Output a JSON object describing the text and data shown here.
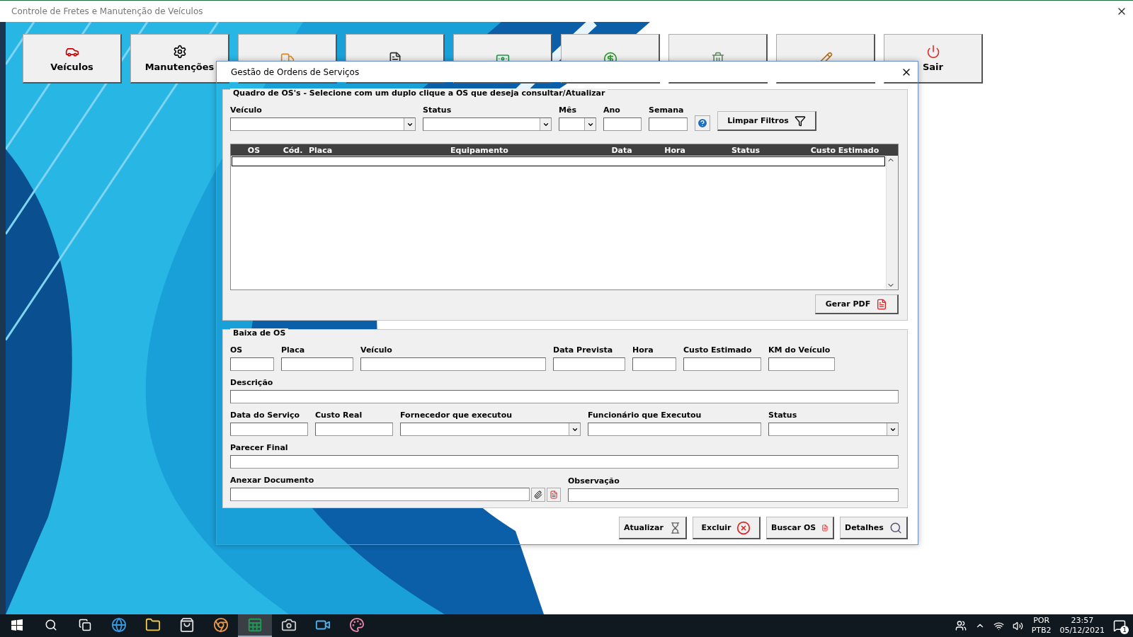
{
  "window": {
    "title": "Controle de Fretes e Manutenção de Veículos"
  },
  "toolbar": [
    {
      "kind": "labeled",
      "label": "Veículos"
    },
    {
      "kind": "labeled",
      "label": "Manutenções"
    },
    {
      "kind": "icon"
    },
    {
      "kind": "icon"
    },
    {
      "kind": "icon"
    },
    {
      "kind": "icon"
    },
    {
      "kind": "icon"
    },
    {
      "kind": "icon"
    },
    {
      "kind": "labeled",
      "label": "Sair"
    }
  ],
  "dialog": {
    "title": "Gestão de Ordens de Serviços",
    "filter_frame": {
      "title": "Quadro de OS's - Selecione com um duplo clique a OS que deseja consultar/Atualizar",
      "fields": [
        {
          "label": "Veículo",
          "kind": "combo"
        },
        {
          "label": "Status",
          "kind": "combo"
        },
        {
          "label": "Mês",
          "kind": "combo"
        },
        {
          "label": "Ano",
          "kind": "text"
        },
        {
          "label": "Semana",
          "kind": "text"
        }
      ],
      "clear_button": "Limpar Filtros",
      "table": {
        "columns": [
          "OS",
          "Cód.",
          "Placa",
          "Equipamento",
          "Data",
          "Hora",
          "Status",
          "Custo Estimado"
        ]
      },
      "pdf_button": "Gerar PDF"
    },
    "form_frame": {
      "title": "Baixa de OS",
      "lines": [
        {
          "fields": [
            {
              "label": "OS",
              "kind": "text"
            },
            {
              "label": "Placa",
              "kind": "text"
            },
            {
              "label": "Veículo",
              "kind": "text"
            },
            {
              "label": "Data Prevista",
              "kind": "text"
            },
            {
              "label": "Hora",
              "kind": "text"
            },
            {
              "label": "Custo Estimado",
              "kind": "text"
            },
            {
              "label": "KM do Veículo",
              "kind": "text"
            }
          ]
        },
        {
          "fields": [
            {
              "label": "Descrição",
              "kind": "text"
            }
          ]
        },
        {
          "fields": [
            {
              "label": "Data do Serviço",
              "kind": "text"
            },
            {
              "label": "Custo Real",
              "kind": "text"
            },
            {
              "label": "Fornecedor que executou",
              "kind": "combo"
            },
            {
              "label": "Funcionário que Executou",
              "kind": "text"
            },
            {
              "label": "Status",
              "kind": "combo"
            }
          ]
        },
        {
          "fields": [
            {
              "label": "Parecer Final",
              "kind": "text"
            }
          ]
        },
        {
          "fields": [
            {
              "label": "Anexar Documento",
              "kind": "attach"
            },
            {
              "label": "Observação",
              "kind": "text"
            }
          ]
        }
      ]
    },
    "buttons": [
      "Atualizar",
      "Excluir",
      "Buscar OS",
      "Detalhes"
    ]
  },
  "taskbar": {
    "apps": [
      {
        "selected": false
      },
      {
        "selected": false
      },
      {
        "selected": false
      },
      {
        "selected": false
      },
      {
        "selected": true
      },
      {
        "selected": false
      },
      {
        "selected": false
      },
      {
        "selected": false
      }
    ],
    "tray": {
      "language": "POR",
      "layout": "PTB2",
      "time": "23:57",
      "date": "05/12/2021",
      "notifications": "1"
    }
  }
}
